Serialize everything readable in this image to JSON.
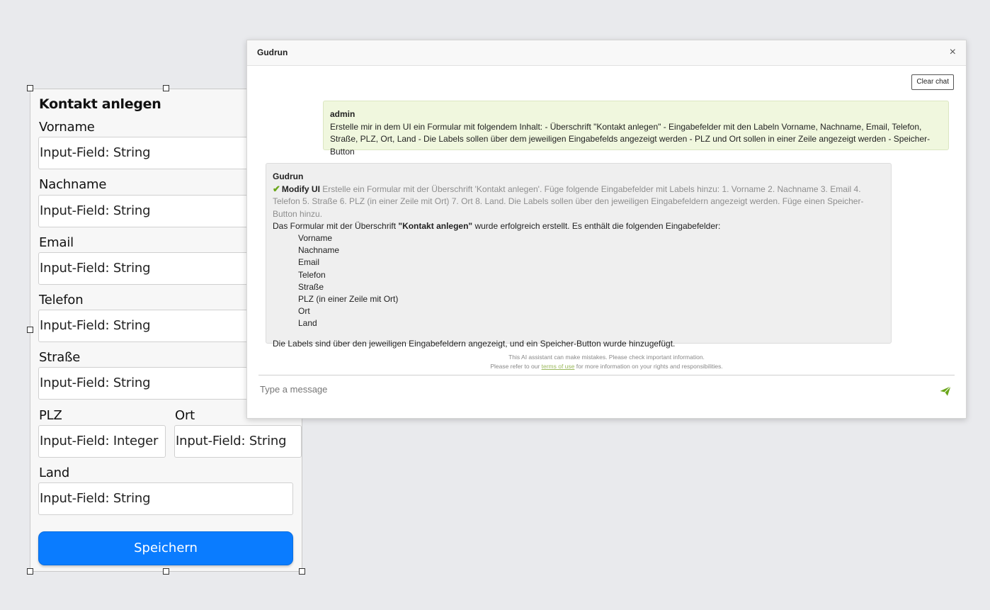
{
  "form": {
    "title": "Kontakt anlegen",
    "fields": {
      "vorname": {
        "label": "Vorname",
        "placeholder": "Input-Field: String"
      },
      "nachname": {
        "label": "Nachname",
        "placeholder": "Input-Field: String"
      },
      "email": {
        "label": "Email",
        "placeholder": "Input-Field: String"
      },
      "telefon": {
        "label": "Telefon",
        "placeholder": "Input-Field: String"
      },
      "strasse": {
        "label": "Straße",
        "placeholder": "Input-Field: String"
      },
      "plz": {
        "label": "PLZ",
        "placeholder": "Input-Field: Integer"
      },
      "ort": {
        "label": "Ort",
        "placeholder": "Input-Field: String"
      },
      "land": {
        "label": "Land",
        "placeholder": "Input-Field: String"
      }
    },
    "save_label": "Speichern",
    "accent_color": "#0a7cff"
  },
  "chat": {
    "title": "Gudrun",
    "close_glyph": "×",
    "clear_label": "Clear chat",
    "messages": {
      "user": {
        "sender": "admin",
        "text": "Erstelle mir in dem UI ein Formular mit folgendem Inhalt: - Überschrift \"Kontakt anlegen\" - Eingabefelder mit den Labeln Vorname, Nachname, Email, Telefon, Straße, PLZ, Ort, Land - Die Labels sollen über dem jeweiligen Eingabefelds angezeigt werden - PLZ und Ort sollen in einer Zeile angezeigt werden - Speicher-Button"
      },
      "assistant": {
        "sender": "Gudrun",
        "tool_icon": "check-icon",
        "tool_name": "Modify UI",
        "tool_description": "Erstelle ein Formular mit der Überschrift 'Kontakt anlegen'. Füge folgende Eingabefelder mit Labels hinzu: 1. Vorname 2. Nachname 3. Email 4. Telefon 5. Straße 6. PLZ (in einer Zeile mit Ort) 7. Ort 8. Land. Die Labels sollen über den jeweiligen Eingabefeldern angezeigt werden. Füge einen Speicher-Button hinzu.",
        "intro_before": "Das Formular mit der Überschrift ",
        "intro_bold": "\"Kontakt anlegen\"",
        "intro_after": " wurde erfolgreich erstellt. Es enthält die folgenden Eingabefelder:",
        "field_list": {
          "0": "Vorname",
          "1": "Nachname",
          "2": "Email",
          "3": "Telefon",
          "4": "Straße",
          "5": "PLZ (in einer Zeile mit Ort)",
          "6": "Ort",
          "7": "Land"
        },
        "summary": "Die Labels sind über den jeweiligen Eingabefeldern angezeigt, und ein Speicher-Button wurde hinzugefügt."
      }
    },
    "disclaimer": {
      "line1": "This AI assistant can make mistakes. Please check important information.",
      "line2_before": "Please refer to our ",
      "terms_link": "terms of use",
      "line2_after": " for more information on your rights and responsibilities."
    },
    "input_placeholder": "Type a message",
    "send_icon": "send-icon",
    "user_bubble_color": "#f0f7de",
    "assistant_bubble_color": "#efefef",
    "brand_green": "#6aa61a"
  }
}
